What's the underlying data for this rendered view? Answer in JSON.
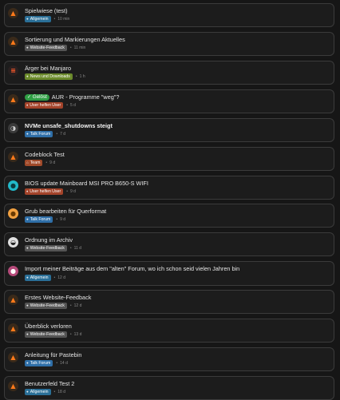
{
  "colors": {
    "Allgemein": "#2a6f97",
    "Website-Feedback": "#545454",
    "News und Downloads": "#6b8a2b",
    "User helfen User": "#a3432a",
    "Talk Forum": "#2f6fa8",
    "Team": "#a04a2a",
    "solved": "#2f9e44"
  },
  "topics": [
    {
      "avatar": "fox-icon",
      "title": "Spielwiese (test)",
      "bold": false,
      "category": "Allgemein",
      "age": "10 min"
    },
    {
      "avatar": "fox-icon",
      "title": "Sortierung und Markierungen Aktuelles",
      "bold": false,
      "category": "Website-Feedback",
      "age": "11 min"
    },
    {
      "avatar": "stack-icon",
      "title": "Ärger bei Manjaro",
      "bold": false,
      "category": "News und Downloads",
      "age": "1 h"
    },
    {
      "avatar": "fox-icon",
      "solved": "✓ Gelöst",
      "title": "AUR - Programme \"weg\"?",
      "bold": false,
      "category": "User helfen User",
      "age": "5 d"
    },
    {
      "avatar": "globe-icon",
      "title": "NVMe unsafe_shutdowns steigt",
      "bold": true,
      "category": "Talk Forum",
      "age": "7 d"
    },
    {
      "avatar": "fox-icon",
      "title": "Codeblock Test",
      "bold": false,
      "category": "Team",
      "age": "9 d"
    },
    {
      "avatar": "teal-avatar-icon",
      "title": "BIOS update Mainboard MSI PRO B650-S WIFI",
      "bold": false,
      "category": "User helfen User",
      "age": "9 d"
    },
    {
      "avatar": "orange-avatar-icon",
      "title": "Grub bearbeiten für Querformat",
      "bold": false,
      "category": "Talk Forum",
      "age": "9 d"
    },
    {
      "avatar": "bw-avatar-icon",
      "title": "Ordnung im Archiv",
      "bold": false,
      "category": "Website-Feedback",
      "age": "11 d"
    },
    {
      "avatar": "pink-avatar-icon",
      "title": "Import meiner Beiträge aus dem \"alten\" Forum, wo ich schon seid vielen Jahren bin",
      "bold": false,
      "category": "Allgemein",
      "age": "12 d"
    },
    {
      "avatar": "fox-icon",
      "title": "Erstes Website-Feedback",
      "bold": false,
      "category": "Website-Feedback",
      "age": "12 d"
    },
    {
      "avatar": "fox-icon",
      "title": "Überblick verloren",
      "bold": false,
      "category": "Website-Feedback",
      "age": "13 d"
    },
    {
      "avatar": "fox-icon",
      "title": "Anleitung für Pastebin",
      "bold": false,
      "category": "Talk Forum",
      "age": "14 d"
    },
    {
      "avatar": "fox-icon",
      "title": "Benutzerfeld Test 2",
      "bold": false,
      "category": "Allgemein",
      "age": "18 d"
    }
  ]
}
